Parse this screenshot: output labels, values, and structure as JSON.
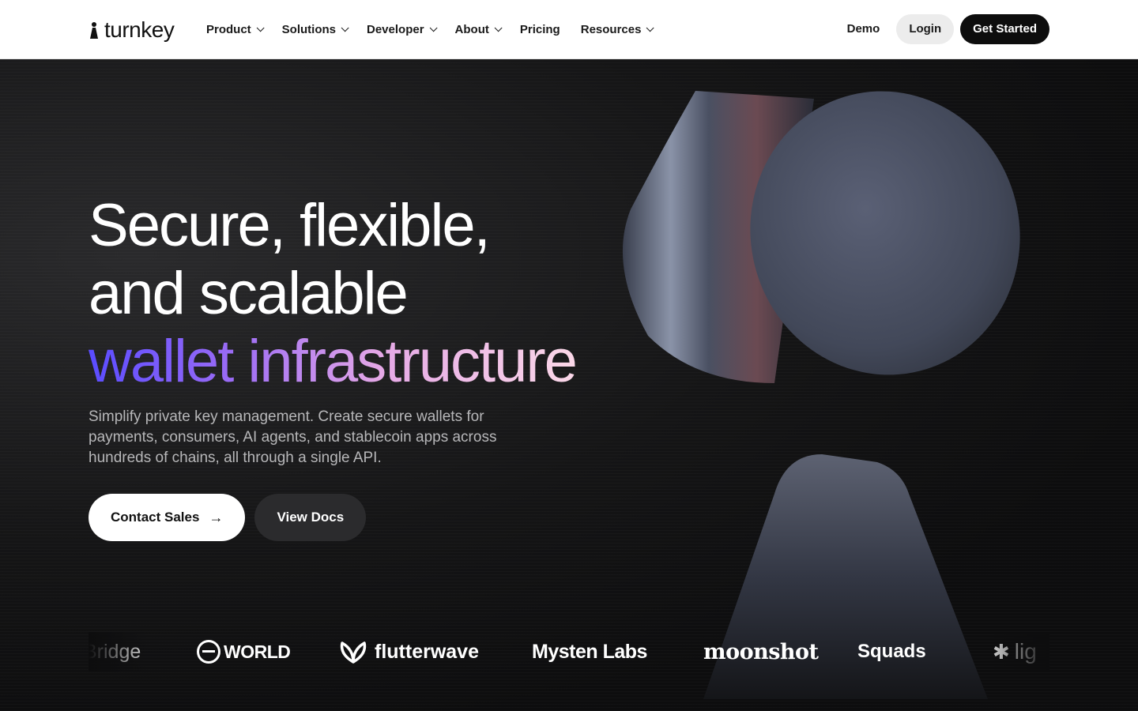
{
  "nav": {
    "brand": "turnkey",
    "menu": [
      {
        "label": "Product",
        "dropdown": true
      },
      {
        "label": "Solutions",
        "dropdown": true
      },
      {
        "label": "Developer",
        "dropdown": true
      },
      {
        "label": "About",
        "dropdown": true
      },
      {
        "label": "Pricing",
        "dropdown": false
      },
      {
        "label": "Resources",
        "dropdown": true
      }
    ],
    "demo_label": "Demo",
    "login_label": "Login",
    "get_started_label": "Get Started"
  },
  "hero": {
    "headline_line1": "Secure, flexible,",
    "headline_line2": "and scalable",
    "headline_line3": "wallet infrastructure",
    "subtitle": "Simplify private key management. Create secure wallets for payments, consumers, AI agents, and stablecoin apps across hundreds of chains, all through a single API.",
    "contact_label": "Contact Sales",
    "docs_label": "View Docs",
    "arrow_icon": "arrow-right-icon"
  },
  "partners": [
    {
      "name": "Bridge"
    },
    {
      "name": "WORLD"
    },
    {
      "name": "flutterwave"
    },
    {
      "name": "Mysten Labs"
    },
    {
      "name": "moonshot"
    },
    {
      "name": "Squads"
    },
    {
      "name": "lig"
    }
  ],
  "colors": {
    "nav_bg": "#ffffff",
    "hero_bg": "#0d0d0e",
    "primary_button": "#0d0d0d",
    "gradient_start": "#5a4cff",
    "gradient_end": "#fbd8e8"
  }
}
